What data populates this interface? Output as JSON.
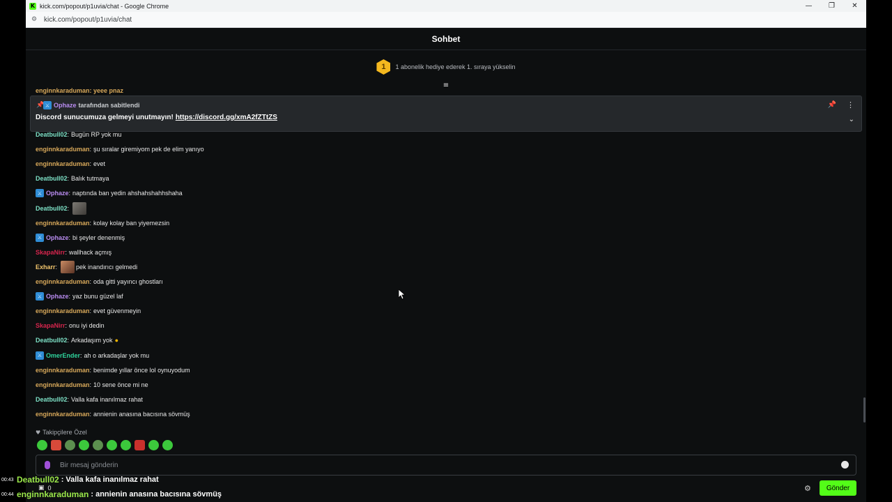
{
  "browser": {
    "title": "kick.com/popout/p1uvia/chat - Google Chrome",
    "url": "kick.com/popout/p1uvia/chat",
    "favicon_letter": "K"
  },
  "chat": {
    "title": "Sohbet",
    "gift_rank": "1",
    "gift_text": "1 abonelik hediye ederek 1. sıraya yükselin",
    "partial_top": "enginnkaraduman: yeee pnaz",
    "pinned": {
      "pinned_by_user": "Ophaze",
      "pinned_by_text": "tarafından sabitlendi",
      "message": "Discord sunucumuza gelmeyi unutmayın!",
      "link": "https://discord.gg/xmA2fZTtZS"
    },
    "messages": [
      {
        "user": "Deatbull02",
        "color": "#7ee2c7",
        "badge": false,
        "text": "Bugün RP yok mu"
      },
      {
        "user": "enginnkaraduman",
        "color": "#d7a85a",
        "badge": false,
        "text": "şu sıralar giremiyom pek de elim yanıyo"
      },
      {
        "user": "enginnkaraduman",
        "color": "#d7a85a",
        "badge": false,
        "text": "evet"
      },
      {
        "user": "Deatbull02",
        "color": "#7ee2c7",
        "badge": false,
        "text": "Balık tutmaya"
      },
      {
        "user": "Ophaze",
        "color": "#b98cf0",
        "badge": true,
        "text": "naptında ban yedin ahshahshahhshaha"
      },
      {
        "user": "Deatbull02",
        "color": "#7ee2c7",
        "badge": false,
        "text": ""
      },
      {
        "user": "enginnkaraduman",
        "color": "#d7a85a",
        "badge": false,
        "text": "kolay kolay ban yiyemezsin"
      },
      {
        "user": "Ophaze",
        "color": "#b98cf0",
        "badge": true,
        "text": "bi şeyler denenmiş"
      },
      {
        "user": "SkapaNirr",
        "color": "#d6254d",
        "badge": false,
        "text": "wallhack açmış"
      },
      {
        "user": "Exharr",
        "color": "#f2c66d",
        "badge": false,
        "text": "pek inandırıcı gelmedi"
      },
      {
        "user": "enginnkaraduman",
        "color": "#d7a85a",
        "badge": false,
        "text": "oda gitti yayıncı ghostları"
      },
      {
        "user": "Ophaze",
        "color": "#b98cf0",
        "badge": true,
        "text": "yaz bunu güzel laf"
      },
      {
        "user": "enginnkaraduman",
        "color": "#d7a85a",
        "badge": false,
        "text": "evet güvenmeyin"
      },
      {
        "user": "SkapaNirr",
        "color": "#d6254d",
        "badge": false,
        "text": "onu iyi dedin"
      },
      {
        "user": "Deatbull02",
        "color": "#7ee2c7",
        "badge": false,
        "text": "Arkadaşım yok"
      },
      {
        "user": "OmerEnder",
        "color": "#2fd39c",
        "badge": true,
        "text": "ah o arkadaşlar yok mu"
      },
      {
        "user": "enginnkaraduman",
        "color": "#d7a85a",
        "badge": false,
        "text": "benimde yıllar önce lol oynuyodum"
      },
      {
        "user": "enginnkaraduman",
        "color": "#d7a85a",
        "badge": false,
        "text": "10 sene önce mi ne"
      },
      {
        "user": "Deatbull02",
        "color": "#7ee2c7",
        "badge": false,
        "text": "Valla kafa inanılmaz rahat"
      },
      {
        "user": "enginnkaraduman",
        "color": "#d7a85a",
        "badge": false,
        "text": "annienin anasına bacısına sövmüş"
      }
    ],
    "followers_label": "Takipçilere Özel",
    "input_placeholder": "Bir mesaj gönderin",
    "points": "0",
    "send_label": "Gönder"
  },
  "overlay": [
    {
      "time": "00:43",
      "user": "Deatbull02",
      "color": "#9be84a",
      "text": ": Valla kafa inanılmaz rahat"
    },
    {
      "time": "00:44",
      "user": "enginnkaraduman",
      "color": "#9be84a",
      "text": ": annienin anasına bacısına sövmüş"
    }
  ],
  "colors": {
    "accent": "#53fc18",
    "background": "#0d0f10",
    "pinned_bg": "#25282b"
  }
}
